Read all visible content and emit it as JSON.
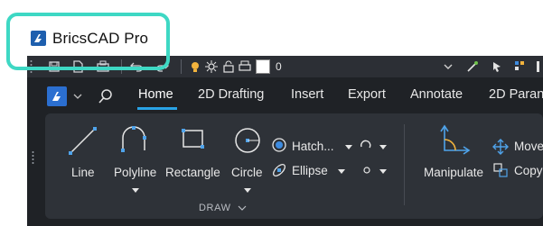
{
  "app": {
    "title": "BricsCAD Pro",
    "logo_icon": "bricscad-logo-icon"
  },
  "quick_access": {
    "icons": [
      "grip-icon",
      "save-icon",
      "new-file-icon",
      "saveas-icon",
      "undo-icon",
      "redo-icon",
      "bulb-icon",
      "sun-icon",
      "lock-icon",
      "print-icon"
    ],
    "layer_name": "0",
    "layer_color": "#ffffff",
    "right_icons": [
      "pick-icon",
      "select-icon",
      "properties-icon",
      "more-icon"
    ]
  },
  "ribbon": {
    "tabs": [
      "Home",
      "2D Drafting",
      "Insert",
      "Export",
      "Annotate",
      "2D Paran"
    ],
    "active_tab": "Home",
    "accent": "#29a3e6"
  },
  "draw_panel": {
    "label": "DRAW",
    "tools": [
      "Line",
      "Polyline",
      "Rectangle",
      "Circle"
    ],
    "small_tools": [
      "Hatch...",
      "Ellipse"
    ],
    "manipulate": "Manipulate",
    "modify_tools": [
      "Move",
      "Copy"
    ]
  }
}
